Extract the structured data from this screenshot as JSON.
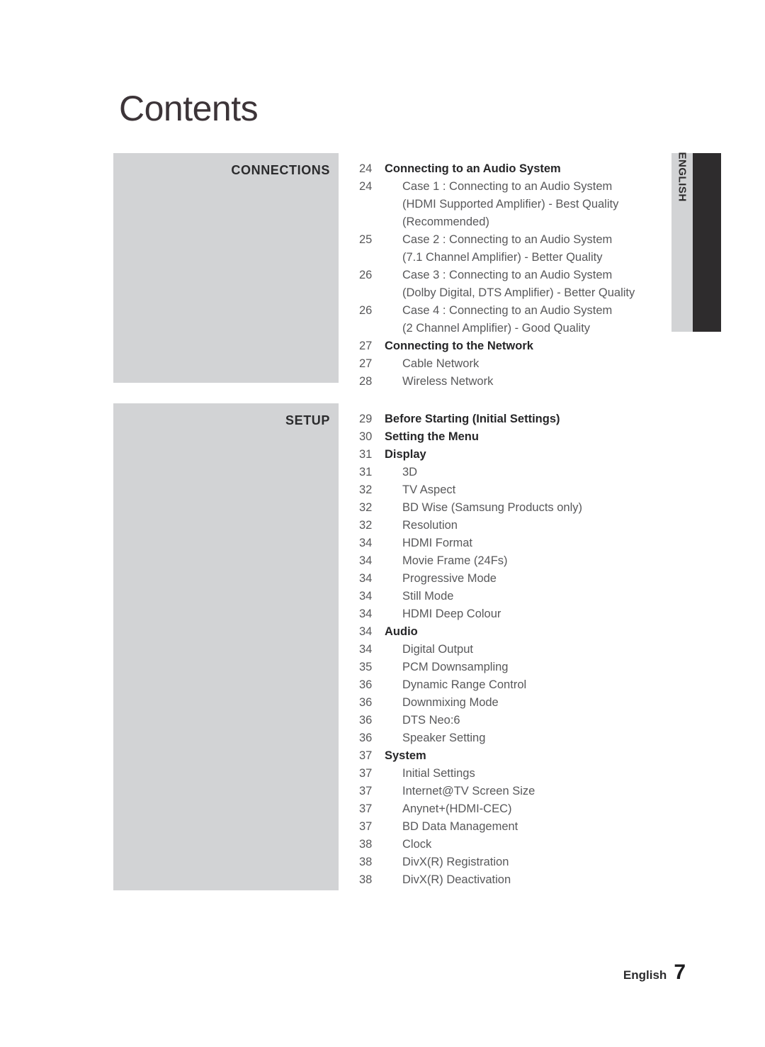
{
  "page": {
    "title": "Contents",
    "language_tab": "ENGLISH",
    "footer_language": "English",
    "footer_page_number": "7",
    "accent_grey": "#d2d3d5",
    "accent_dark": "#2e2c2d",
    "text_dark": "#262628",
    "text_body": "#58585a"
  },
  "sections": [
    {
      "id": "connections",
      "title": "CONNECTIONS",
      "entries": [
        {
          "page": "24",
          "level": 1,
          "lines": [
            "Connecting to an Audio System"
          ]
        },
        {
          "page": "24",
          "level": 2,
          "lines": [
            "Case 1 : Connecting to an Audio System",
            "(HDMI Supported Amplifier) - Best Quality",
            "(Recommended)"
          ]
        },
        {
          "page": "25",
          "level": 2,
          "lines": [
            "Case 2 : Connecting to an Audio System",
            "(7.1 Channel Amplifier) - Better Quality"
          ]
        },
        {
          "page": "26",
          "level": 2,
          "lines": [
            "Case 3 : Connecting to an Audio System",
            "(Dolby Digital, DTS Amplifier) - Better Quality"
          ]
        },
        {
          "page": "26",
          "level": 2,
          "lines": [
            "Case 4 : Connecting to an Audio System",
            "(2 Channel Amplifier) - Good Quality"
          ]
        },
        {
          "page": "27",
          "level": 1,
          "lines": [
            "Connecting to the Network"
          ]
        },
        {
          "page": "27",
          "level": 2,
          "lines": [
            "Cable Network"
          ]
        },
        {
          "page": "28",
          "level": 2,
          "lines": [
            "Wireless Network"
          ]
        }
      ]
    },
    {
      "id": "setup",
      "title": "SETUP",
      "entries": [
        {
          "page": "29",
          "level": 1,
          "lines": [
            "Before Starting (Initial Settings)"
          ]
        },
        {
          "page": "30",
          "level": 1,
          "lines": [
            "Setting the Menu"
          ]
        },
        {
          "page": "31",
          "level": 1,
          "lines": [
            "Display"
          ]
        },
        {
          "page": "31",
          "level": 2,
          "lines": [
            "3D"
          ]
        },
        {
          "page": "32",
          "level": 2,
          "lines": [
            "TV Aspect"
          ]
        },
        {
          "page": "32",
          "level": 2,
          "lines": [
            "BD Wise (Samsung Products only)"
          ]
        },
        {
          "page": "32",
          "level": 2,
          "lines": [
            "Resolution"
          ]
        },
        {
          "page": "34",
          "level": 2,
          "lines": [
            "HDMI Format"
          ]
        },
        {
          "page": "34",
          "level": 2,
          "lines": [
            "Movie Frame (24Fs)"
          ]
        },
        {
          "page": "34",
          "level": 2,
          "lines": [
            "Progressive Mode"
          ]
        },
        {
          "page": "34",
          "level": 2,
          "lines": [
            "Still Mode"
          ]
        },
        {
          "page": "34",
          "level": 2,
          "lines": [
            "HDMI Deep Colour"
          ]
        },
        {
          "page": "34",
          "level": 1,
          "lines": [
            "Audio"
          ]
        },
        {
          "page": "34",
          "level": 2,
          "lines": [
            "Digital Output"
          ]
        },
        {
          "page": "35",
          "level": 2,
          "lines": [
            "PCM Downsampling"
          ]
        },
        {
          "page": "36",
          "level": 2,
          "lines": [
            "Dynamic Range Control"
          ]
        },
        {
          "page": "36",
          "level": 2,
          "lines": [
            "Downmixing Mode"
          ]
        },
        {
          "page": "36",
          "level": 2,
          "lines": [
            "DTS Neo:6"
          ]
        },
        {
          "page": "36",
          "level": 2,
          "lines": [
            "Speaker Setting"
          ]
        },
        {
          "page": "37",
          "level": 1,
          "lines": [
            "System"
          ]
        },
        {
          "page": "37",
          "level": 2,
          "lines": [
            "Initial Settings"
          ]
        },
        {
          "page": "37",
          "level": 2,
          "lines": [
            "Internet@TV Screen Size"
          ]
        },
        {
          "page": "37",
          "level": 2,
          "lines": [
            "Anynet+(HDMI-CEC)"
          ]
        },
        {
          "page": "37",
          "level": 2,
          "lines": [
            "BD Data Management"
          ]
        },
        {
          "page": "38",
          "level": 2,
          "lines": [
            "Clock"
          ]
        },
        {
          "page": "38",
          "level": 2,
          "lines": [
            "DivX(R) Registration"
          ]
        },
        {
          "page": "38",
          "level": 2,
          "lines": [
            "DivX(R) Deactivation"
          ]
        }
      ]
    }
  ]
}
